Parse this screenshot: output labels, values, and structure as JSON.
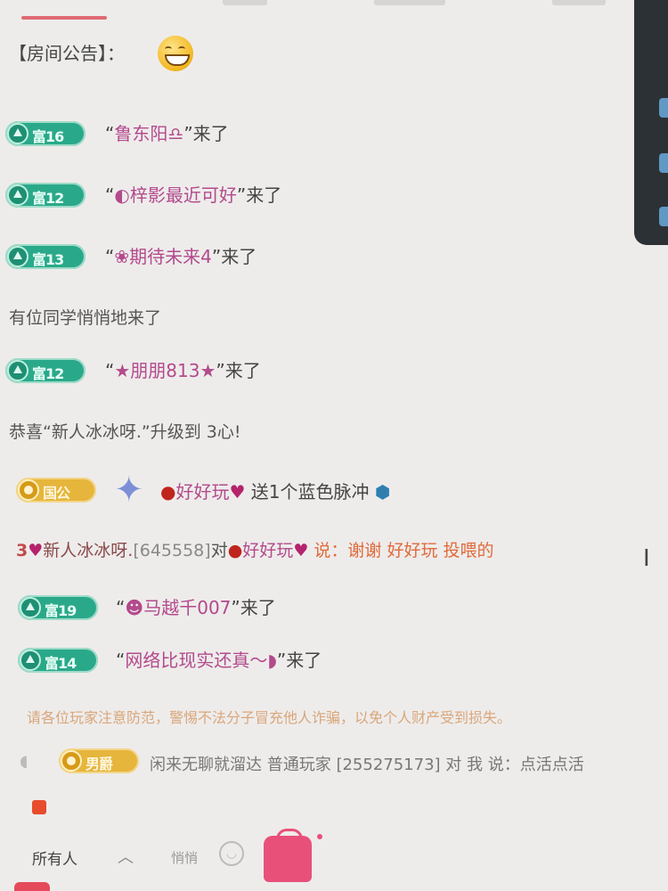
{
  "announcement": {
    "label": "【房间公告】：",
    "emoji": "grin-face-icon"
  },
  "messages": [
    {
      "level": "富16",
      "text_pre": "“",
      "name": "鲁东阳♎",
      "text_post": "”来了",
      "badge": "green"
    },
    {
      "level": "富12",
      "text_pre": "“",
      "name": "◐梓影最近可好",
      "text_post": "”来了",
      "badge": "green"
    },
    {
      "level": "富13",
      "text_pre": "“",
      "name": "❀期待未来4",
      "text_post": "”来了",
      "badge": "green"
    },
    {
      "level": "富12",
      "text_pre": "“",
      "name": "★朋朋813★",
      "text_post": "”来了",
      "badge": "green"
    },
    {
      "level": "富19",
      "text_pre": "“",
      "name": "☻马越千007",
      "text_post": "”来了",
      "badge": "green"
    },
    {
      "level": "富14",
      "text_pre": "“",
      "name": "网络比现实还真～◗",
      "text_post": "”来了",
      "badge": "green"
    }
  ],
  "system": {
    "anonymous": "有位同学悄悄地来了",
    "upgrade": "恭喜“新人冰冰呀.”升级到 3心!"
  },
  "gift": {
    "badge": "国公",
    "sender": "好好玩",
    "action": "送1个蓝色脉冲"
  },
  "chat": {
    "level": "3",
    "user": "新人冰冰呀.",
    "uid": "[645558]",
    "to": "对",
    "target": "好好玩",
    "say": "说：",
    "content": "谢谢 好好玩 投喂的"
  },
  "warning": "请各位玩家注意防范，警惕不法分子冒充他人诈骗，以免个人财产受到损失。",
  "last": {
    "badge": "男爵",
    "text": "闲来无聊就溜达  普通玩家 [255275173] 对 我 说：点活点活"
  },
  "toolbar": {
    "recipient": "所有人",
    "input_placeholder": "悄悄",
    "gift_label": "礼物"
  }
}
